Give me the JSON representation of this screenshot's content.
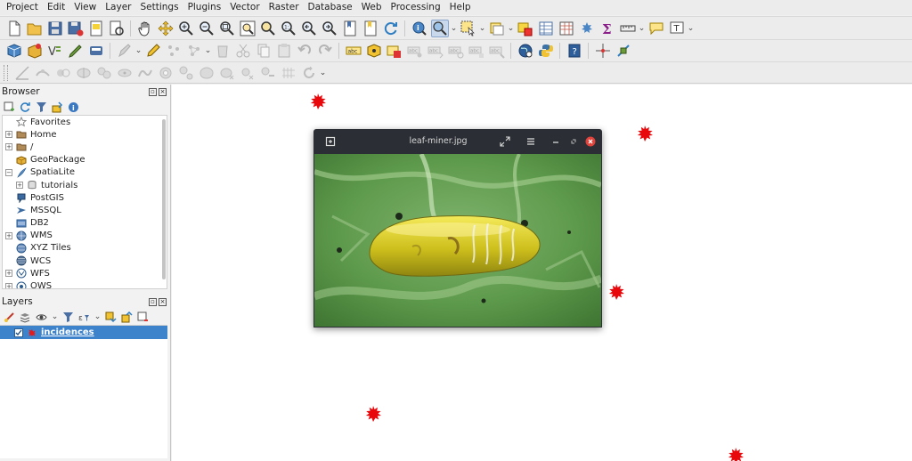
{
  "menu": [
    "Project",
    "Edit",
    "View",
    "Layer",
    "Settings",
    "Plugins",
    "Vector",
    "Raster",
    "Database",
    "Web",
    "Processing",
    "Help"
  ],
  "toolbar_icons": {
    "row1": [
      "new-project-icon",
      "open-project-icon",
      "save-project-icon",
      "save-as-icon",
      "new-print-layout-icon",
      "layout-manager-icon",
      "pan-icon",
      "pan-to-selection-icon",
      "zoom-in-icon",
      "zoom-out-icon",
      "zoom-full-icon",
      "zoom-to-selection-icon",
      "zoom-to-layer-icon",
      "zoom-native-icon",
      "zoom-last-icon",
      "zoom-next-icon",
      "new-bookmark-icon",
      "show-bookmarks-icon",
      "refresh-icon",
      "identify-icon",
      "map-tips-icon",
      "select-features-icon",
      "deselect-icon",
      "open-attribute-table-icon",
      "field-calculator-icon",
      "statistics-icon",
      "sum-icon",
      "measure-icon",
      "annotation-icon",
      "text-annotation-icon"
    ],
    "row2": [
      "data-source-manager-icon",
      "new-geopackage-icon",
      "new-shapefile-icon",
      "digitize-icon",
      "toggle-editing-icon",
      "edits-icon",
      "pencil-icon",
      "add-feature-icon",
      "vertex-tool-icon",
      "move-feature-icon",
      "delete-selected-icon",
      "cut-features-icon",
      "copy-features-icon",
      "paste-features-icon",
      "undo-icon",
      "redo-icon",
      "label-toolbar-icon",
      "layer-labeling-icon",
      "label-pin-icon",
      "label-show-hide-icon",
      "label-move-icon",
      "label-rotate-icon",
      "label-change-icon",
      "globe-icon",
      "python-console-icon",
      "help-icon",
      "crosshair-icon",
      "plugin-icon"
    ],
    "row3": [
      "advanced-digitizing-icon",
      "reshape-icon",
      "offset-curve-icon",
      "split-icon",
      "merge-icon",
      "rotate-icon",
      "simplify-icon",
      "add-ring-icon",
      "add-part-icon",
      "fill-ring-icon",
      "delete-ring-icon",
      "delete-part-icon",
      "reshape-features-icon",
      "split-parts-icon",
      "merge-attributes-icon",
      "rotate-point-icon"
    ]
  },
  "browser": {
    "title": "Browser",
    "items": [
      {
        "label": "Favorites",
        "icon": "star-icon",
        "expander": ""
      },
      {
        "label": "Home",
        "icon": "folder-icon",
        "expander": "+"
      },
      {
        "label": "/",
        "icon": "folder-icon",
        "expander": "+"
      },
      {
        "label": "GeoPackage",
        "icon": "geopackage-icon",
        "expander": ""
      },
      {
        "label": "SpatiaLite",
        "icon": "spatialite-icon",
        "expander": "−"
      },
      {
        "label": "tutorials",
        "icon": "database-icon",
        "expander": "+",
        "indent": true
      },
      {
        "label": "PostGIS",
        "icon": "postgis-icon",
        "expander": ""
      },
      {
        "label": "MSSQL",
        "icon": "mssql-icon",
        "expander": ""
      },
      {
        "label": "DB2",
        "icon": "db2-icon",
        "expander": ""
      },
      {
        "label": "WMS",
        "icon": "wms-icon",
        "expander": "+"
      },
      {
        "label": "XYZ Tiles",
        "icon": "xyz-tiles-icon",
        "expander": ""
      },
      {
        "label": "WCS",
        "icon": "wcs-icon",
        "expander": ""
      },
      {
        "label": "WFS",
        "icon": "wfs-icon",
        "expander": "+"
      },
      {
        "label": "OWS",
        "icon": "ows-icon",
        "expander": "+"
      }
    ]
  },
  "layers": {
    "title": "Layers",
    "items": [
      {
        "label": "incidences",
        "checked": true,
        "symbol_color": "#e31a1c"
      }
    ]
  },
  "viewer": {
    "filename": "leaf-miner.jpg"
  },
  "colors": {
    "point_symbol": "#e8080c",
    "selection": "#3d83cc",
    "viewer_frame": "#2b2e34",
    "close_button": "#e0433c"
  }
}
